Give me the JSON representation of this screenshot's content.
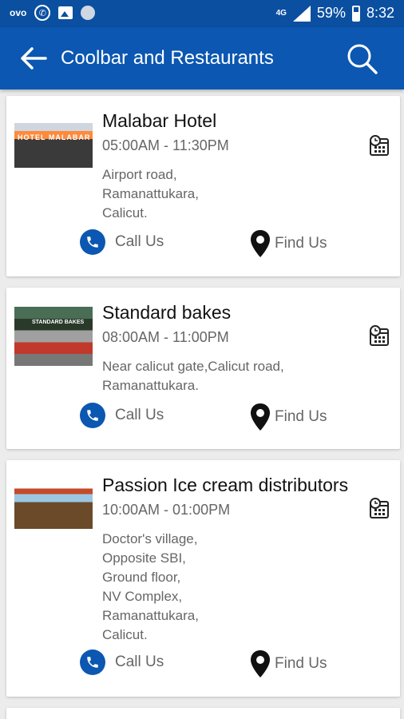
{
  "status_bar": {
    "left_app_label": "ovo",
    "network": "4G",
    "battery": "59%",
    "time": "8:32"
  },
  "app_bar": {
    "title": "Coolbar and Restaurants",
    "back_icon": "arrow-left-icon",
    "search_icon": "search-icon"
  },
  "colors": {
    "primary": "#0b57b1",
    "status_bar": "#0b4fa0",
    "background": "#ececec"
  },
  "restaurants": [
    {
      "name": "Malabar Hotel",
      "hours": "05:00AM - 11:30PM",
      "address": "Airport road,\nRamanattukara,\nCalicut.",
      "call_label": "Call Us",
      "find_label": "Find Us",
      "thumb_text": "HOTEL MALABAR"
    },
    {
      "name": "Standard bakes",
      "hours": "08:00AM - 11:00PM",
      "address": "Near calicut gate,Calicut road,\nRamanattukara.",
      "call_label": "Call Us",
      "find_label": "Find Us",
      "thumb_text": "STANDARD BAKES"
    },
    {
      "name": "Passion Ice cream distributors",
      "hours": "10:00AM - 01:00PM",
      "address": "Doctor's village,\nOpposite SBI,\nGround floor,\nNV Complex,\nRamanattukara,\nCalicut.",
      "call_label": "Call Us",
      "find_label": "Find Us",
      "thumb_text": ""
    }
  ]
}
